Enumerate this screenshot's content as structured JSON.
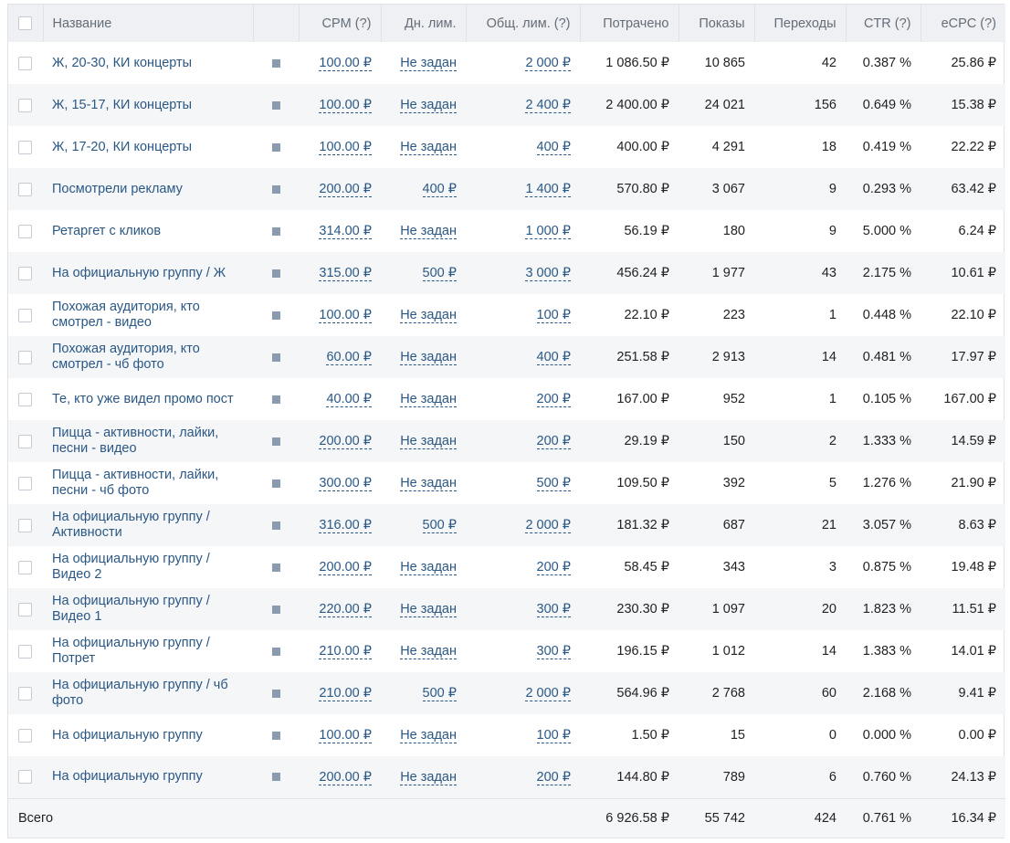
{
  "header": {
    "name": "Название",
    "cpm": "CPM (?)",
    "daily": "Дн. лим.",
    "total": "Общ. лим. (?)",
    "spent": "Потрачено",
    "impressions": "Показы",
    "clicks": "Переходы",
    "ctr": "CTR (?)",
    "ecpc": "eCPC (?)"
  },
  "rows": [
    {
      "name": "Ж, 20-30, КИ концерты",
      "cpm": "100.00 ₽",
      "daily": "Не задан",
      "total": "2 000 ₽",
      "spent": "1 086.50 ₽",
      "impressions": "10 865",
      "clicks": "42",
      "ctr": "0.387 %",
      "ecpc": "25.86 ₽"
    },
    {
      "name": "Ж, 15-17, КИ концерты",
      "cpm": "100.00 ₽",
      "daily": "Не задан",
      "total": "2 400 ₽",
      "spent": "2 400.00 ₽",
      "impressions": "24 021",
      "clicks": "156",
      "ctr": "0.649 %",
      "ecpc": "15.38 ₽"
    },
    {
      "name": "Ж, 17-20, КИ концерты",
      "cpm": "100.00 ₽",
      "daily": "Не задан",
      "total": "400 ₽",
      "spent": "400.00 ₽",
      "impressions": "4 291",
      "clicks": "18",
      "ctr": "0.419 %",
      "ecpc": "22.22 ₽"
    },
    {
      "name": "Посмотрели рекламу",
      "cpm": "200.00 ₽",
      "daily": "400 ₽",
      "total": "1 400 ₽",
      "spent": "570.80 ₽",
      "impressions": "3 067",
      "clicks": "9",
      "ctr": "0.293 %",
      "ecpc": "63.42 ₽"
    },
    {
      "name": "Ретаргет с кликов",
      "cpm": "314.00 ₽",
      "daily": "Не задан",
      "total": "1 000 ₽",
      "spent": "56.19 ₽",
      "impressions": "180",
      "clicks": "9",
      "ctr": "5.000 %",
      "ecpc": "6.24 ₽"
    },
    {
      "name": "На официальную группу / Ж",
      "cpm": "315.00 ₽",
      "daily": "500 ₽",
      "total": "3 000 ₽",
      "spent": "456.24 ₽",
      "impressions": "1 977",
      "clicks": "43",
      "ctr": "2.175 %",
      "ecpc": "10.61 ₽"
    },
    {
      "name": "Похожая аудитория, кто смотрел - видео",
      "cpm": "100.00 ₽",
      "daily": "Не задан",
      "total": "100 ₽",
      "spent": "22.10 ₽",
      "impressions": "223",
      "clicks": "1",
      "ctr": "0.448 %",
      "ecpc": "22.10 ₽"
    },
    {
      "name": "Похожая аудитория, кто смотрел - чб фото",
      "cpm": "60.00 ₽",
      "daily": "Не задан",
      "total": "400 ₽",
      "spent": "251.58 ₽",
      "impressions": "2 913",
      "clicks": "14",
      "ctr": "0.481 %",
      "ecpc": "17.97 ₽"
    },
    {
      "name": "Те, кто уже видел промо пост",
      "cpm": "40.00 ₽",
      "daily": "Не задан",
      "total": "200 ₽",
      "spent": "167.00 ₽",
      "impressions": "952",
      "clicks": "1",
      "ctr": "0.105 %",
      "ecpc": "167.00 ₽"
    },
    {
      "name": "Пицца - активности, лайки, песни - видео",
      "cpm": "200.00 ₽",
      "daily": "Не задан",
      "total": "200 ₽",
      "spent": "29.19 ₽",
      "impressions": "150",
      "clicks": "2",
      "ctr": "1.333 %",
      "ecpc": "14.59 ₽"
    },
    {
      "name": "Пицца - активности, лайки, песни - чб фото",
      "cpm": "300.00 ₽",
      "daily": "Не задан",
      "total": "500 ₽",
      "spent": "109.50 ₽",
      "impressions": "392",
      "clicks": "5",
      "ctr": "1.276 %",
      "ecpc": "21.90 ₽"
    },
    {
      "name": "На официальную группу / Активности",
      "cpm": "316.00 ₽",
      "daily": "500 ₽",
      "total": "2 000 ₽",
      "spent": "181.32 ₽",
      "impressions": "687",
      "clicks": "21",
      "ctr": "3.057 %",
      "ecpc": "8.63 ₽"
    },
    {
      "name": "На официальную группу / Видео 2",
      "cpm": "200.00 ₽",
      "daily": "Не задан",
      "total": "200 ₽",
      "spent": "58.45 ₽",
      "impressions": "343",
      "clicks": "3",
      "ctr": "0.875 %",
      "ecpc": "19.48 ₽"
    },
    {
      "name": "На официальную группу / Видео 1",
      "cpm": "220.00 ₽",
      "daily": "Не задан",
      "total": "300 ₽",
      "spent": "230.30 ₽",
      "impressions": "1 097",
      "clicks": "20",
      "ctr": "1.823 %",
      "ecpc": "11.51 ₽"
    },
    {
      "name": "На официальную группу / Потрет",
      "cpm": "210.00 ₽",
      "daily": "Не задан",
      "total": "300 ₽",
      "spent": "196.15 ₽",
      "impressions": "1 012",
      "clicks": "14",
      "ctr": "1.383 %",
      "ecpc": "14.01 ₽"
    },
    {
      "name": "На официальную группу / чб фото",
      "cpm": "210.00 ₽",
      "daily": "500 ₽",
      "total": "2 000 ₽",
      "spent": "564.96 ₽",
      "impressions": "2 768",
      "clicks": "60",
      "ctr": "2.168 %",
      "ecpc": "9.41 ₽"
    },
    {
      "name": "На официальную группу",
      "cpm": "100.00 ₽",
      "daily": "Не задан",
      "total": "100 ₽",
      "spent": "1.50 ₽",
      "impressions": "15",
      "clicks": "0",
      "ctr": "0.000 %",
      "ecpc": "0.00 ₽"
    },
    {
      "name": "На официальную группу",
      "cpm": "200.00 ₽",
      "daily": "Не задан",
      "total": "200 ₽",
      "spent": "144.80 ₽",
      "impressions": "789",
      "clicks": "6",
      "ctr": "0.760 %",
      "ecpc": "24.13 ₽"
    }
  ],
  "totals": {
    "label": "Всего",
    "spent": "6 926.58 ₽",
    "impressions": "55 742",
    "clicks": "424",
    "ctr": "0.761 %",
    "ecpc": "16.34 ₽"
  },
  "icons": {
    "row_status": "status-square-icon"
  },
  "colors": {
    "link": "#2a5885",
    "header_bg": "#eef0f3",
    "stripe_bg": "#f5f6f8",
    "status": "#8a9bb0"
  }
}
